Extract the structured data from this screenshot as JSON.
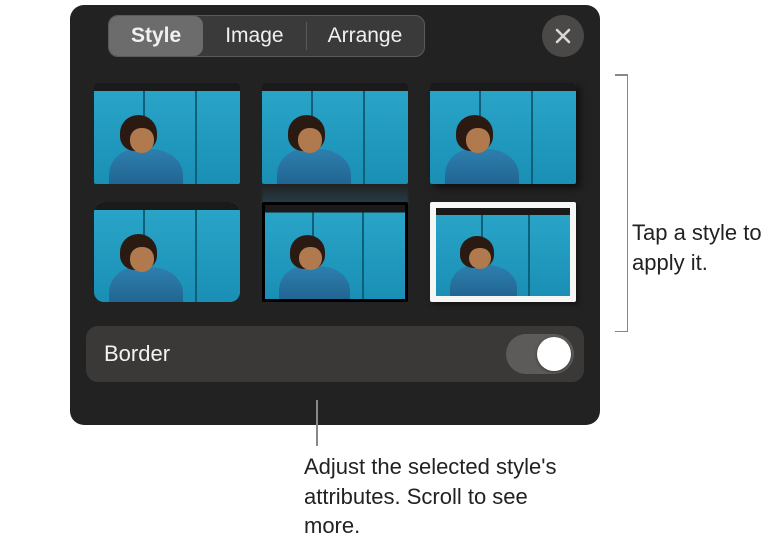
{
  "tabs": {
    "style": "Style",
    "image": "Image",
    "arrange": "Arrange",
    "active": "style"
  },
  "close_icon": "close-icon",
  "styles": [
    {
      "name": "plain"
    },
    {
      "name": "reflection"
    },
    {
      "name": "shadow"
    },
    {
      "name": "rounded"
    },
    {
      "name": "black-frame"
    },
    {
      "name": "white-frame"
    }
  ],
  "border": {
    "label": "Border",
    "on": false
  },
  "callouts": {
    "right": "Tap a style to apply it.",
    "bottom": "Adjust the selected style's attributes. Scroll to see more."
  }
}
